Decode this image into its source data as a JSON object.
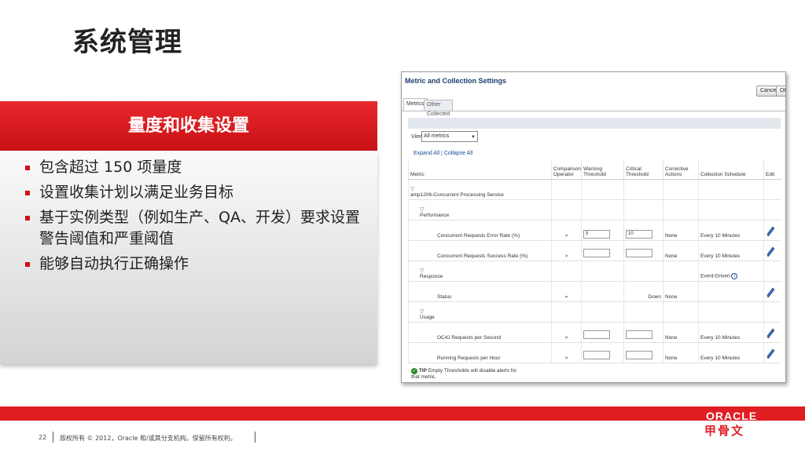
{
  "slide": {
    "title": "系统管理",
    "section_header": "量度和收集设置",
    "bullets": [
      "包含超过 150 项量度",
      "设置收集计划以满足业务目标",
      "基于实例类型（例如生产、QA、开发）要求设置警告阈值和严重阈值",
      "能够自动执行正确操作"
    ],
    "page_number": "22",
    "copyright": "版权所有 © 2012，Oracle 和/或其分支机构。保留所有权利。",
    "logo_text": "ORACLE",
    "logo_cn": "甲骨文",
    "colors": {
      "accent": "#e01e22",
      "link": "#1a4d8f"
    }
  },
  "screenshot": {
    "title": "Metric and Collection Settings",
    "buttons": {
      "cancel": "Cancel",
      "ok": "OK"
    },
    "tabs": [
      "Metrics",
      "Other Collected Items"
    ],
    "view_label": "View",
    "view_selected": "All metrics",
    "expand_all": "Expand All",
    "collapse_all": "Collapse All",
    "link_sep": "|",
    "columns": {
      "metric": "Metric",
      "comparison": "Comparison Operator",
      "warning": "Warning Threshold",
      "critical": "Critical Threshold",
      "corrective": "Corrective Actions",
      "schedule": "Collection Schedule",
      "edit": "Edit"
    },
    "groups": {
      "service": "amp1206-Concurrent Processing Service",
      "performance": "Performance",
      "response": "Response",
      "usage": "Usage"
    },
    "rows": {
      "error_rate": {
        "metric": "Concurrent Requests Error Rate (%)",
        "op": ">",
        "warning": "5",
        "critical": "10",
        "actions": "None",
        "schedule": "Every 10 Minutes"
      },
      "success_rate": {
        "metric": "Concurrent Requests Success Rate (%)",
        "op": ">",
        "warning": "",
        "critical": "",
        "actions": "None",
        "schedule": "Every 10 Minutes"
      },
      "response_schedule": "Event-Driven",
      "status": {
        "metric": "Status",
        "op": "=",
        "critical": "Down",
        "actions": "None"
      },
      "oc4j": {
        "metric": "OC4J Requests per Second",
        "op": ">",
        "warning": "",
        "critical": "",
        "actions": "None",
        "schedule": "Every 10 Minutes"
      },
      "running": {
        "metric": "Running Requests per Hour",
        "op": ">",
        "warning": "",
        "critical": "",
        "actions": "None",
        "schedule": "Every 10 Minutes"
      }
    },
    "tip_label": "TIP",
    "tip_text": "Empty Thresholds will disable alerts for that metric."
  }
}
